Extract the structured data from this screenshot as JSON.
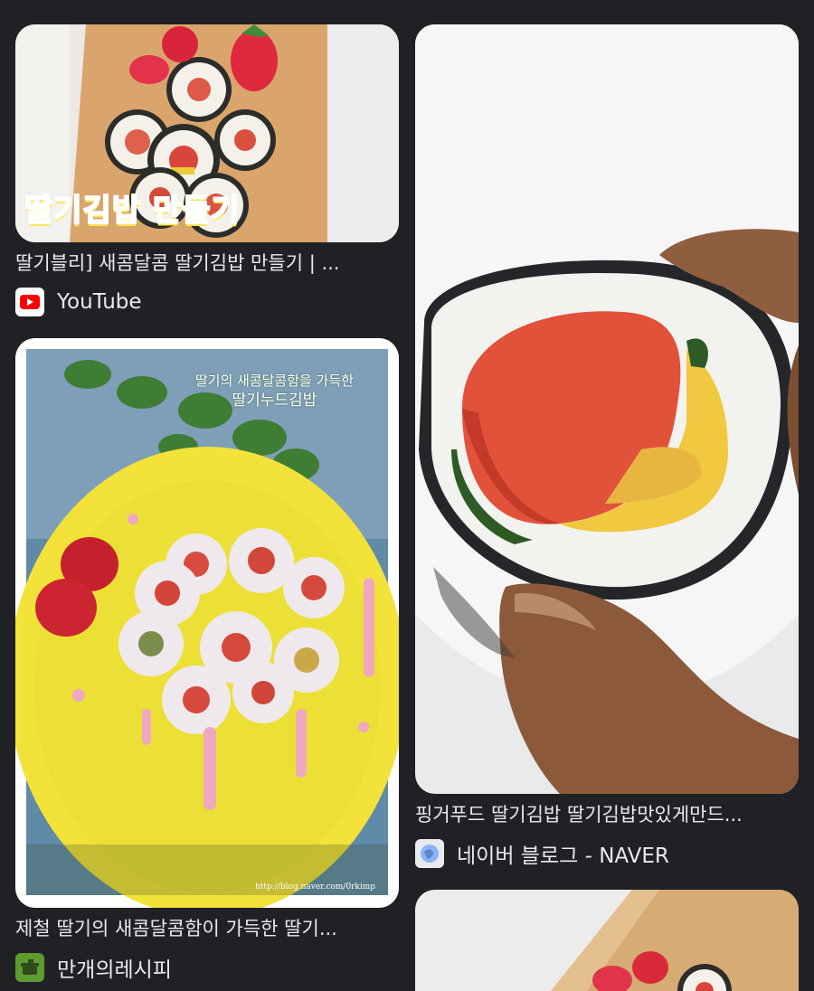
{
  "results": [
    {
      "caption": "딸기블리] 새콤달콤 딸기김밥 만들기 | ...",
      "source": "YouTube",
      "overlay_text": "딸기김밥 만들기",
      "icon": "youtube-icon",
      "icon_color": "#ff0000"
    },
    {
      "caption": "제철 딸기의 새콤달콤함이 가득한 딸기...",
      "source": "만개의레시피",
      "overlay_text_line1": "딸기의 새콤달콤함을 가득한",
      "overlay_text_line2": "딸기누드김밥",
      "watermark": "http://blog.naver.com/0rkimp",
      "icon": "recipe-pot-icon",
      "icon_color": "#5d9c2f"
    },
    {
      "caption": "핑거푸드 딸기김밥 딸기김밥맛있게만드...",
      "source": "네이버 블로그 - NAVER",
      "icon": "naver-blog-icon",
      "icon_color": "#8ab4f8"
    },
    {
      "caption": "",
      "source": "",
      "icon": "image-thumbnail"
    }
  ]
}
